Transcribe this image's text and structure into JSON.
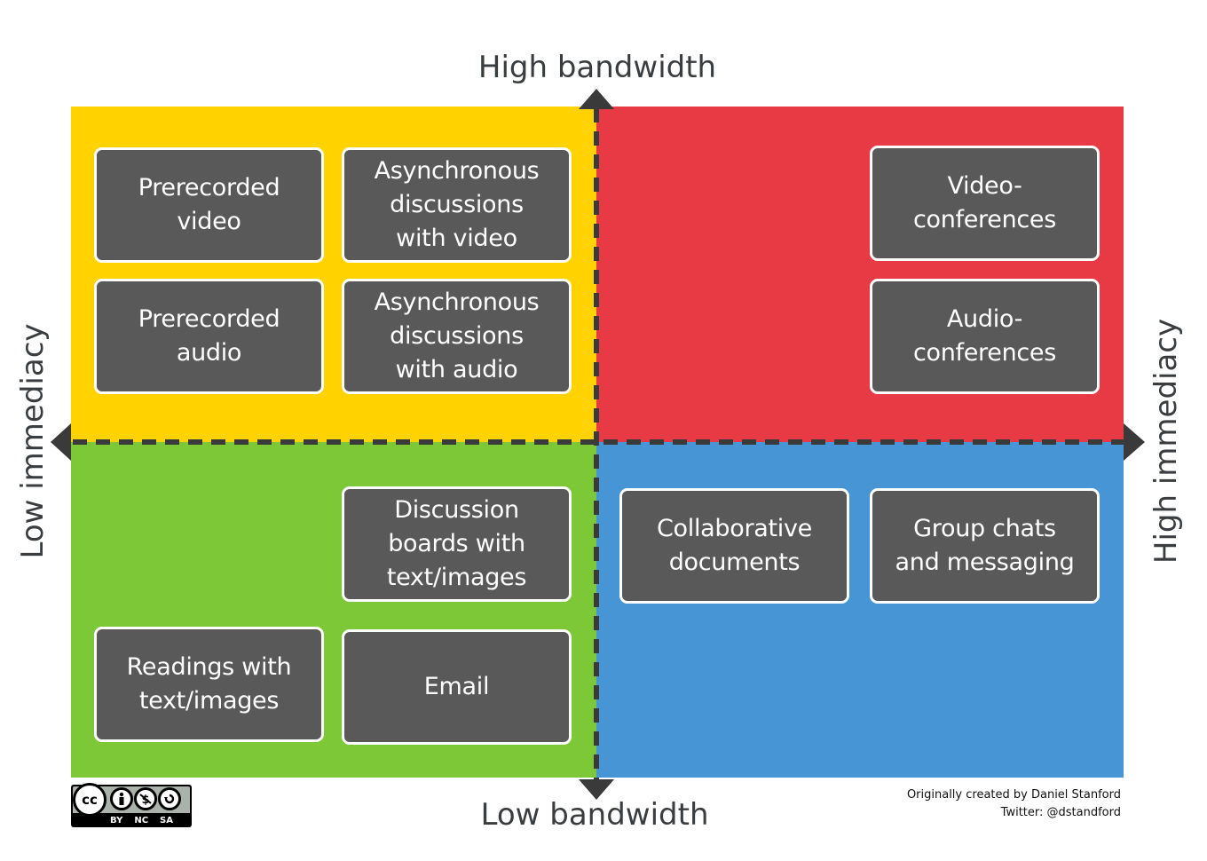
{
  "axes": {
    "top": "High bandwidth",
    "bottom": "Low bandwidth",
    "left": "Low immediacy",
    "right": "High immediacy"
  },
  "colors": {
    "top_left": "#FFD200",
    "top_right": "#E83A45",
    "bottom_left": "#7CC837",
    "bottom_right": "#4795D4",
    "box_fill": "#595959",
    "box_border": "#FFFFFF",
    "axis": "#3A3A3A"
  },
  "quadrants": {
    "top_left": {
      "items": [
        "Prerecorded\nvideo",
        "Asynchronous\ndiscussions\nwith video",
        "Prerecorded\naudio",
        "Asynchronous\ndiscussions\nwith audio"
      ]
    },
    "top_right": {
      "items": [
        "Video-\nconferences",
        "Audio-\nconferences"
      ]
    },
    "bottom_left": {
      "items": [
        "Discussion\nboards with\ntext/images",
        "Readings with\ntext/images",
        "Email"
      ]
    },
    "bottom_right": {
      "items": [
        "Collaborative\ndocuments",
        "Group chats\nand messaging"
      ]
    }
  },
  "license": {
    "badge": "cc",
    "tags": [
      "BY",
      "NC",
      "SA"
    ]
  },
  "credit": {
    "line1": "Originally created by Daniel Stanford",
    "line2": "Twitter: @dstandford"
  }
}
